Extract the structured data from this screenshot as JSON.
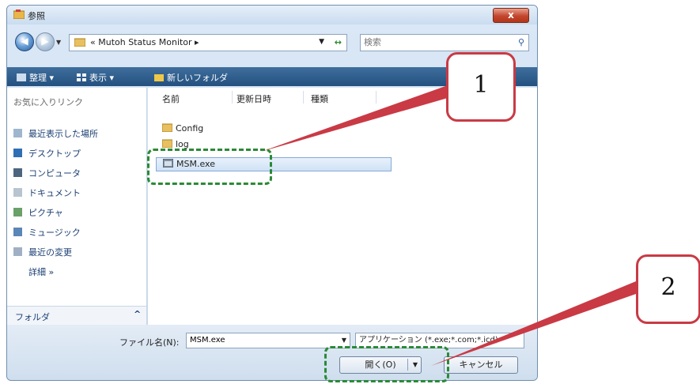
{
  "window": {
    "title": "参照",
    "close_label": "x"
  },
  "nav": {
    "back_label": "◀",
    "forward_label": "▶"
  },
  "address": {
    "path": "« Mutoh Status Monitor ▸"
  },
  "search": {
    "placeholder": "検索"
  },
  "toolbar": {
    "organize": "整理 ▾",
    "view": "表示 ▾",
    "new_folder": "新しいフォルダ"
  },
  "sidebar": {
    "header": "お気に入りリンク",
    "items": [
      "最近表示した場所",
      "デスクトップ",
      "コンピュータ",
      "ドキュメント",
      "ピクチャ",
      "ミュージック",
      "最近の変更",
      "詳細 »"
    ],
    "folders_label": "フォルダ"
  },
  "columns": [
    "名前",
    "更新日時",
    "種類"
  ],
  "files": [
    "Config",
    "log",
    "MSM.exe"
  ],
  "filename": {
    "label": "ファイル名(N):",
    "value": "MSM.exe"
  },
  "filetype": {
    "value": "アプリケーション (*.exe;*.com;*.icd)"
  },
  "buttons": {
    "open": "開く(O)",
    "cancel": "キャンセル"
  },
  "callouts": {
    "one": "1",
    "two": "2"
  },
  "colors": {
    "highlight": "#2a8a36",
    "callout_border": "#c93a45",
    "toolbar": "#2d5b8a"
  }
}
